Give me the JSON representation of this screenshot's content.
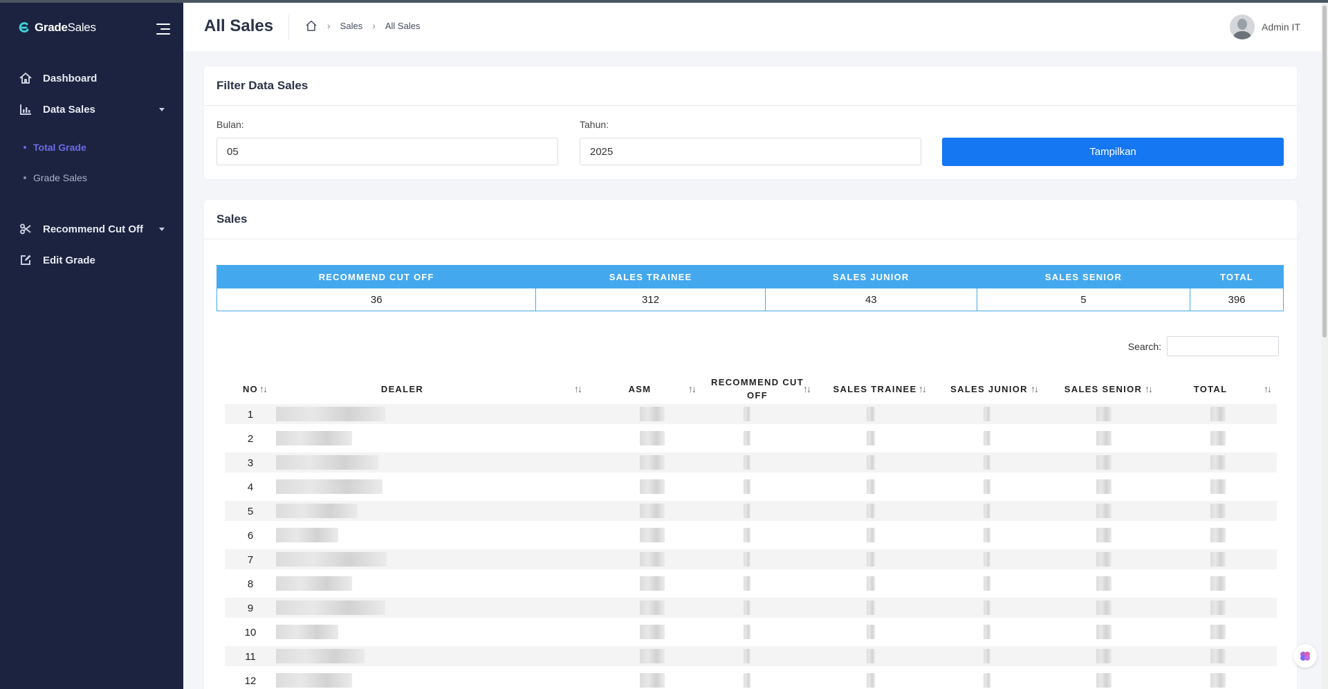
{
  "app": {
    "brand_bold": "Grade",
    "brand_rest": "Sales"
  },
  "sidebar": {
    "items": [
      {
        "label": "Dashboard",
        "icon": "home-icon"
      },
      {
        "label": "Data Sales",
        "icon": "bar-chart-icon",
        "expanded": true
      },
      {
        "label": "Recommend Cut Off",
        "icon": "scissors-icon"
      },
      {
        "label": "Edit Grade",
        "icon": "edit-icon"
      }
    ],
    "sub_items": [
      {
        "label": "Total Grade",
        "active": true
      },
      {
        "label": "Grade Sales",
        "active": false
      }
    ]
  },
  "header": {
    "title": "All Sales",
    "breadcrumb": [
      "Sales",
      "All Sales"
    ],
    "user_name": "Admin IT"
  },
  "filter": {
    "title": "Filter Data Sales",
    "month_label": "Bulan:",
    "month_value": "05",
    "year_label": "Tahun:",
    "year_value": "2025",
    "submit_label": "Tampilkan"
  },
  "sales": {
    "title": "Sales",
    "summary_headers": [
      "RECOMMEND CUT OFF",
      "SALES TRAINEE",
      "SALES JUNIOR",
      "SALES SENIOR",
      "TOTAL"
    ],
    "summary_values": [
      "36",
      "312",
      "43",
      "5",
      "396"
    ],
    "search_label": "Search:",
    "columns": [
      "NO",
      "DEALER",
      "ASM",
      "RECOMMEND CUT OFF",
      "SALES TRAINEE",
      "SALES JUNIOR",
      "SALES SENIOR",
      "TOTAL"
    ],
    "row_numbers": [
      "1",
      "2",
      "3",
      "4",
      "5",
      "6",
      "7",
      "8",
      "9",
      "10",
      "11",
      "12"
    ]
  },
  "colors": {
    "sidebar": "#1b2340",
    "accent": "#1677f2",
    "summary_header": "#44a8ee",
    "active_sub": "#6d6ce8"
  }
}
